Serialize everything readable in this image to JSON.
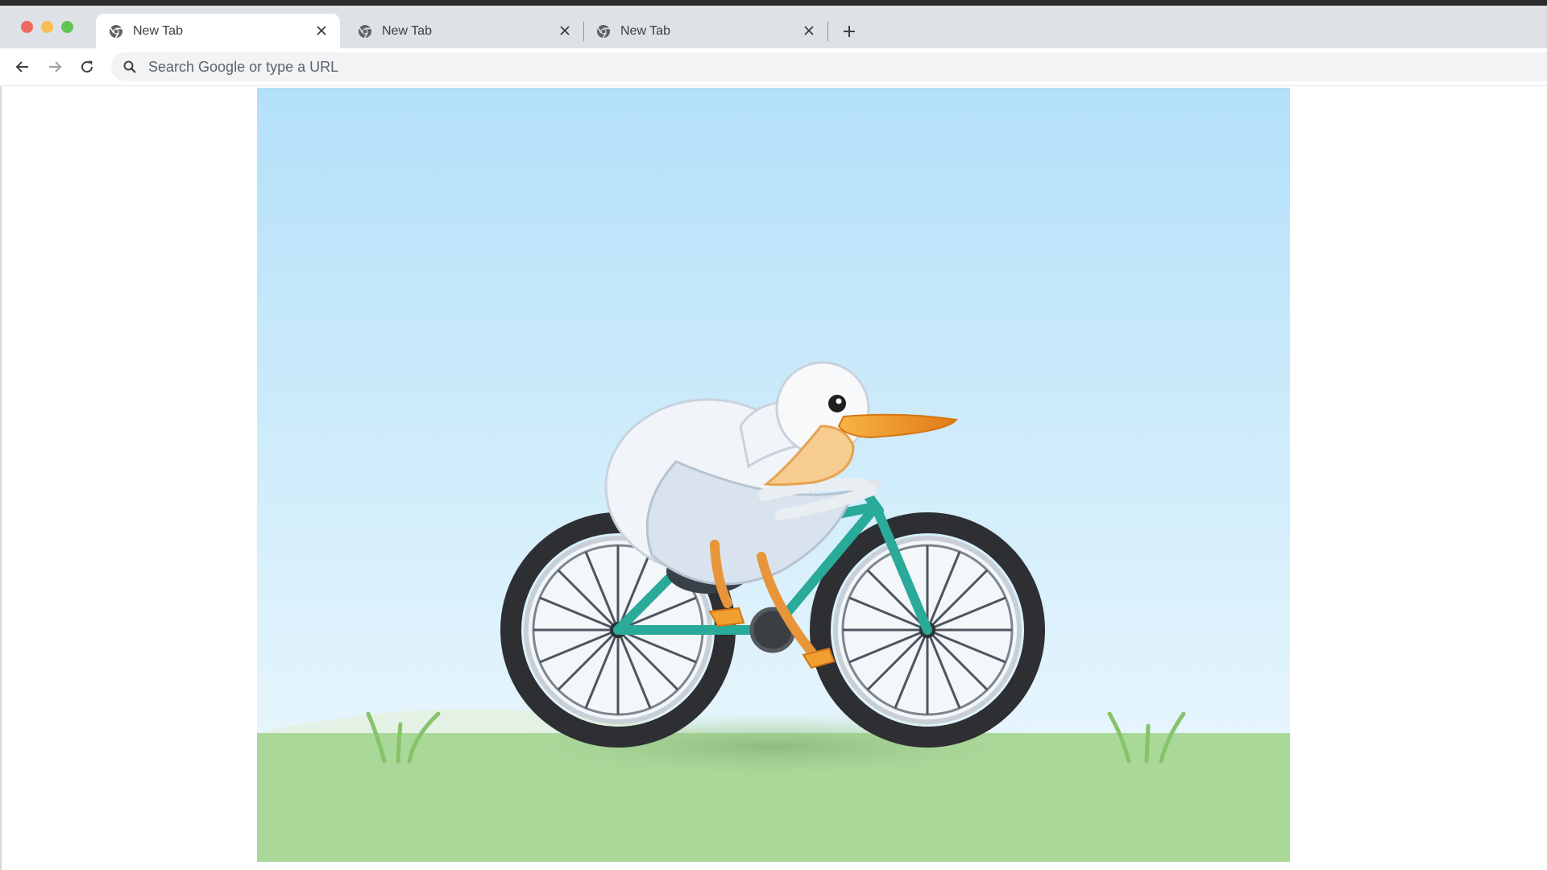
{
  "tabs": [
    {
      "title": "New Tab",
      "active": true
    },
    {
      "title": "New Tab",
      "active": false
    },
    {
      "title": "New Tab",
      "active": false
    }
  ],
  "omnibox": {
    "placeholder": "Search Google or type a URL"
  },
  "colors": {
    "sky_top": "#b3e0f9",
    "sky_bottom": "#eef8fd",
    "grass": "#aad899",
    "bike_frame": "#2aaa98",
    "tire": "#2d2f33",
    "beak": "#f0a030",
    "bird_body": "#f1f4f8"
  },
  "icons": {
    "tab_favicon": "chrome-icon",
    "tab_close": "close-icon",
    "new_tab": "plus-icon",
    "back": "arrow-back-icon",
    "forward": "arrow-forward-icon",
    "reload": "reload-icon",
    "search": "search-icon"
  }
}
